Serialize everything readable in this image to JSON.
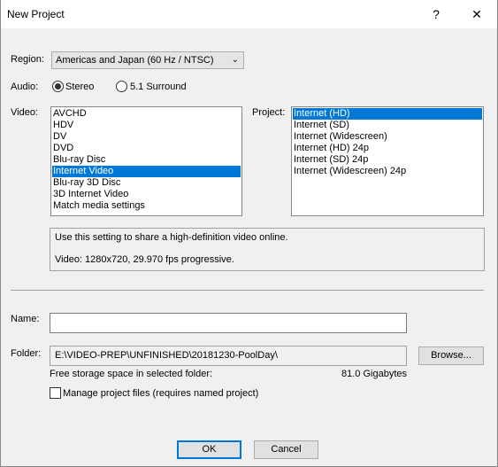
{
  "window": {
    "title": "New Project",
    "help_label": "?",
    "close_label": "✕"
  },
  "region": {
    "label": "Region:",
    "value": "Americas and Japan (60 Hz / NTSC)"
  },
  "audio": {
    "label": "Audio:",
    "options": [
      {
        "label": "Stereo",
        "selected": true
      },
      {
        "label": "5.1 Surround",
        "selected": false
      }
    ]
  },
  "video": {
    "label": "Video:",
    "items": [
      "AVCHD",
      "HDV",
      "DV",
      "DVD",
      "Blu-ray Disc",
      "Internet Video",
      "Blu-ray 3D Disc",
      "3D Internet Video",
      "Match media settings"
    ],
    "selected": "Internet Video"
  },
  "project": {
    "label": "Project:",
    "items": [
      "Internet (HD)",
      "Internet (SD)",
      "Internet (Widescreen)",
      "Internet (HD) 24p",
      "Internet (SD) 24p",
      "Internet (Widescreen) 24p"
    ],
    "selected": "Internet (HD)"
  },
  "description": {
    "line1": "Use this setting to share a high-definition video online.",
    "line2": "Video: 1280x720, 29.970 fps progressive."
  },
  "name": {
    "label": "Name:",
    "value": ""
  },
  "folder": {
    "label": "Folder:",
    "value": "E:\\VIDEO-PREP\\UNFINISHED\\20181230-PoolDay\\",
    "browse_label": "Browse..."
  },
  "storage": {
    "label": "Free storage space in selected folder:",
    "value": "81.0 Gigabytes"
  },
  "manage": {
    "label": "Manage project files (requires named project)",
    "checked": false
  },
  "buttons": {
    "ok": "OK",
    "cancel": "Cancel"
  }
}
